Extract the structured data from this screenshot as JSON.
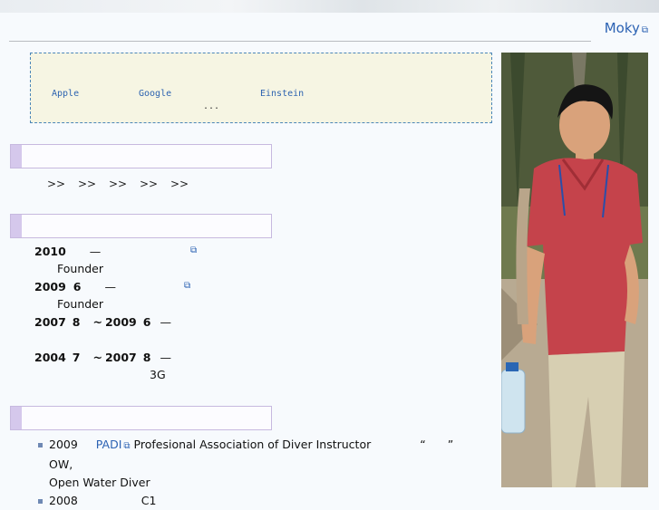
{
  "header": {
    "site_name": "Moky",
    "external_link_glyph": "⧉"
  },
  "quote_box": {
    "words": [
      "Apple",
      "Google",
      "Einstein"
    ],
    "ellipsis": "..."
  },
  "nav": {
    "items": [
      ">>",
      ">>",
      ">>",
      ">>",
      ">>"
    ]
  },
  "experience": [
    {
      "year": "2010",
      "dash": "—",
      "role": "Founder"
    },
    {
      "year": "2009",
      "month": "6",
      "dash": "—",
      "role": "Founder"
    },
    {
      "start_year": "2007",
      "start_month": "8",
      "sep": "~",
      "end_year": "2009",
      "end_month": "6",
      "dash": "—"
    },
    {
      "start_year": "2004",
      "start_month": "7",
      "sep": "~",
      "end_year": "2007",
      "end_month": "8",
      "dash": "—",
      "note": "3G"
    }
  ],
  "certifications": {
    "items": [
      {
        "year": "2009",
        "link": "PADI",
        "text": "Profesional Association of Diver Instructor",
        "quote_open": "“",
        "quote_close": "”",
        "level": "OW,",
        "continuation": "Open Water Diver"
      },
      {
        "year": "2008",
        "text": "C1"
      }
    ]
  },
  "colors": {
    "accent": "#2c62b3",
    "section_bar": "#d5c8ec",
    "quote_bg": "#f6f5e3"
  }
}
